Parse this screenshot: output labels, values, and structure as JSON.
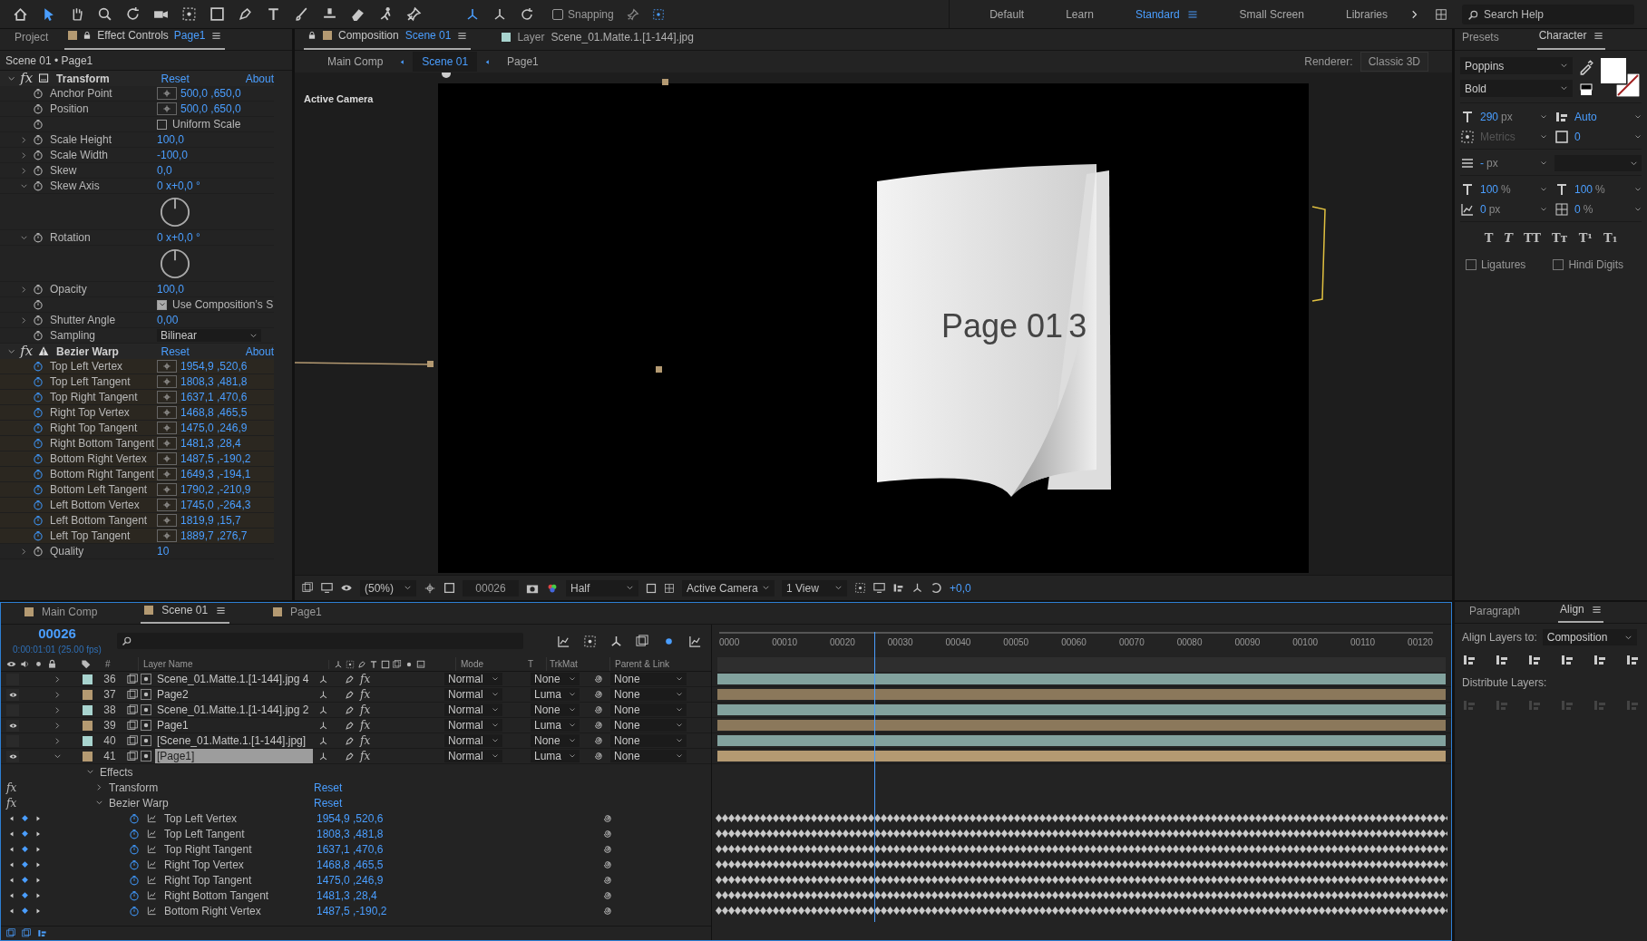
{
  "toolbar": {
    "snapping": {
      "label": "Snapping",
      "checked": false
    },
    "workspaces": [
      {
        "label": "Default",
        "selected": false
      },
      {
        "label": "Learn",
        "selected": false
      },
      {
        "label": "Standard",
        "selected": true
      },
      {
        "label": "Small Screen",
        "selected": false
      },
      {
        "label": "Libraries",
        "selected": false
      }
    ],
    "search": {
      "placeholder": "Search Help"
    }
  },
  "effect_controls": {
    "tabs": [
      {
        "label": "Project",
        "selected": false
      },
      {
        "label": "Effect Controls",
        "target": "Page1",
        "selected": true
      }
    ],
    "breadcrumb": "Scene 01 • Page1",
    "effects": [
      {
        "name": "Transform",
        "fx_label": "fx",
        "warning": false,
        "reset": "Reset",
        "about": "About",
        "props": [
          {
            "kind": "point",
            "name": "Anchor Point",
            "value": "500,0 ,650,0",
            "keyframed": false,
            "expandable": false
          },
          {
            "kind": "point",
            "name": "Position",
            "value": "500,0 ,650,0",
            "keyframed": false,
            "expandable": false
          },
          {
            "kind": "checkbox",
            "label": "Uniform Scale",
            "checked": false
          },
          {
            "kind": "value",
            "name": "Scale Height",
            "value": "100,0",
            "keyframed": false,
            "expandable": true
          },
          {
            "kind": "value",
            "name": "Scale Width",
            "value": "-100,0",
            "keyframed": false,
            "expandable": true
          },
          {
            "kind": "value",
            "name": "Skew",
            "value": "0,0",
            "keyframed": false,
            "expandable": true
          },
          {
            "kind": "dial",
            "name": "Skew Axis",
            "value": "0 x+0,0 °",
            "expanded": true
          },
          {
            "kind": "dial",
            "name": "Rotation",
            "value": "0 x+0,0 °",
            "expanded": true
          },
          {
            "kind": "value",
            "name": "Opacity",
            "value": "100,0",
            "keyframed": false,
            "expandable": true
          },
          {
            "kind": "checkbox",
            "label": "Use Composition’s S",
            "checked": true
          },
          {
            "kind": "value",
            "name": "Shutter Angle",
            "value": "0,00",
            "keyframed": false,
            "expandable": true
          },
          {
            "kind": "dropdown",
            "name": "Sampling",
            "value": "Bilinear"
          }
        ]
      },
      {
        "name": "Bezier Warp",
        "fx_label": "fx",
        "warning": true,
        "reset": "Reset",
        "about": "About",
        "props": [
          {
            "kind": "point",
            "name": "Top Left Vertex",
            "value": "1954,9 ,520,6",
            "keyframed": true,
            "expandable": false
          },
          {
            "kind": "point",
            "name": "Top Left Tangent",
            "value": "1808,3 ,481,8",
            "keyframed": true,
            "expandable": false
          },
          {
            "kind": "point",
            "name": "Top Right Tangent",
            "value": "1637,1 ,470,6",
            "keyframed": true,
            "expandable": false
          },
          {
            "kind": "point",
            "name": "Right Top Vertex",
            "value": "1468,8 ,465,5",
            "keyframed": true,
            "expandable": false
          },
          {
            "kind": "point",
            "name": "Right Top Tangent",
            "value": "1475,0 ,246,9",
            "keyframed": true,
            "expandable": false
          },
          {
            "kind": "point",
            "name": "Right Bottom Tangent",
            "value": "1481,3 ,28,4",
            "keyframed": true,
            "expandable": false
          },
          {
            "kind": "point",
            "name": "Bottom Right Vertex",
            "value": "1487,5 ,-190,2",
            "keyframed": true,
            "expandable": false
          },
          {
            "kind": "point",
            "name": "Bottom Right Tangent",
            "value": "1649,3 ,-194,1",
            "keyframed": true,
            "expandable": false
          },
          {
            "kind": "point",
            "name": "Bottom Left Tangent",
            "value": "1790,2 ,-210,9",
            "keyframed": true,
            "expandable": false
          },
          {
            "kind": "point",
            "name": "Left Bottom Vertex",
            "value": "1745,0 ,-264,3",
            "keyframed": true,
            "expandable": false
          },
          {
            "kind": "point",
            "name": "Left Bottom Tangent",
            "value": "1819,9 ,15,7",
            "keyframed": true,
            "expandable": false
          },
          {
            "kind": "point",
            "name": "Left Top Tangent",
            "value": "1889,7 ,276,7",
            "keyframed": true,
            "expandable": false
          },
          {
            "kind": "value",
            "name": "Quality",
            "value": "10",
            "keyframed": false,
            "expandable": true
          }
        ]
      }
    ]
  },
  "viewer": {
    "tabs": [
      {
        "label": "Composition",
        "target": "Scene 01",
        "color": "#b49a72",
        "selected": true
      },
      {
        "label": "Layer",
        "target": "Scene_01.Matte.1.[1-144].jpg",
        "color": "#a8d4cf",
        "selected": false
      }
    ],
    "breadcrumbs": [
      {
        "label": "Main Comp",
        "selected": false
      },
      {
        "label": "Scene 01",
        "selected": true
      },
      {
        "label": "Page1",
        "selected": false
      }
    ],
    "renderer_label": "Renderer:",
    "renderer": "Classic 3D",
    "camera_label": "Active Camera",
    "frame_texts": [
      "Page 01",
      "3"
    ],
    "controls": {
      "zoom": "(50%)",
      "frame": "00026",
      "resolution": "Half",
      "view": "Active Camera",
      "layout": "1 View",
      "exposure": "+0,0"
    }
  },
  "character": {
    "tabs": [
      {
        "label": "Presets",
        "selected": false
      },
      {
        "label": "Character",
        "selected": true
      }
    ],
    "font": "Poppins",
    "style": "Bold",
    "size": {
      "value": "290",
      "unit": "px"
    },
    "leading": "Auto",
    "kerning": "Metrics",
    "tracking": "0",
    "stroke": {
      "value": "-",
      "unit": "px"
    },
    "vscale": {
      "value": "100",
      "unit": "%"
    },
    "hscale": {
      "value": "100",
      "unit": "%"
    },
    "baseline": {
      "value": "0",
      "unit": "px"
    },
    "tsume": {
      "value": "0",
      "unit": "%"
    },
    "style_buttons": [
      "T",
      "T",
      "TT",
      "Tт",
      "T¹",
      "T₁"
    ],
    "options": [
      {
        "label": "Ligatures",
        "checked": false
      },
      {
        "label": "Hindi Digits",
        "checked": false
      }
    ]
  },
  "timeline": {
    "tabs": [
      {
        "label": "Main Comp",
        "color": "#b49a72",
        "selected": false
      },
      {
        "label": "Scene 01",
        "color": "#b49a72",
        "selected": true
      },
      {
        "label": "Page1",
        "color": "#b49a72",
        "selected": false
      }
    ],
    "timecode": "00026",
    "timecode_detail": "0:00:01:01 (25.00 fps)",
    "columns": [
      "#",
      "Layer Name",
      "Mode",
      "T",
      "TrkMat",
      "Parent & Link"
    ],
    "ruler": [
      "0000",
      "00010",
      "00020",
      "00030",
      "00040",
      "00050",
      "00060",
      "00070",
      "00080",
      "00090",
      "00100",
      "00110",
      "00120"
    ],
    "playhead": {
      "level": 0.217
    },
    "layers": [
      {
        "number": "36",
        "fx_label": "fx",
        "effects_on": true,
        "name": "Scene_01.Matte.1.[1-144].jpg 4",
        "color": "#a8d4cf",
        "visible": false,
        "mode": "Normal",
        "trkmat": "None",
        "parent": "None",
        "selected": false,
        "expanded": false
      },
      {
        "number": "37",
        "fx_label": "fx",
        "effects_on": true,
        "name": "Page2",
        "color": "#b49a72",
        "visible": true,
        "mode": "Normal",
        "trkmat": "Luma",
        "parent": "None",
        "selected": false,
        "expanded": false
      },
      {
        "number": "38",
        "fx_label": "fx",
        "effects_on": true,
        "name": "Scene_01.Matte.1.[1-144].jpg 2",
        "color": "#a8d4cf",
        "visible": false,
        "mode": "Normal",
        "trkmat": "None",
        "parent": "None",
        "selected": false,
        "expanded": false
      },
      {
        "number": "39",
        "fx_label": "fx",
        "effects_on": true,
        "name": "Page1",
        "color": "#b49a72",
        "visible": true,
        "mode": "Normal",
        "trkmat": "Luma",
        "parent": "None",
        "selected": false,
        "expanded": false
      },
      {
        "number": "40",
        "fx_label": "fx",
        "effects_on": true,
        "name": "[Scene_01.Matte.1.[1-144].jpg]",
        "color": "#a8d4cf",
        "visible": false,
        "mode": "Normal",
        "trkmat": "None",
        "parent": "None",
        "selected": false,
        "expanded": false
      },
      {
        "number": "41",
        "fx_label": "fx",
        "effects_on": true,
        "name": "[Page1]",
        "color": "#b49a72",
        "visible": true,
        "mode": "Normal",
        "trkmat": "Luma",
        "parent": "None",
        "selected": true,
        "expanded": true
      }
    ],
    "effects_label": "Effects",
    "effects": [
      {
        "name": "Transform",
        "fx_label": "fx",
        "reset": "Reset",
        "expanded": false
      },
      {
        "name": "Bezier Warp",
        "fx_label": "fx",
        "reset": "Reset",
        "expanded": true
      }
    ],
    "props": [
      {
        "name": "Top Left Vertex",
        "value": "1954,9 ,520,6"
      },
      {
        "name": "Top Left Tangent",
        "value": "1808,3 ,481,8"
      },
      {
        "name": "Top Right Tangent",
        "value": "1637,1 ,470,6"
      },
      {
        "name": "Right Top Vertex",
        "value": "1468,8 ,465,5"
      },
      {
        "name": "Right Top Tangent",
        "value": "1475,0 ,246,9"
      },
      {
        "name": "Right Bottom Tangent",
        "value": "1481,3 ,28,4"
      },
      {
        "name": "Bottom Right Vertex",
        "value": "1487,5 ,-190,2"
      }
    ]
  },
  "align": {
    "tabs": [
      {
        "label": "Paragraph",
        "selected": false
      },
      {
        "label": "Align",
        "selected": true
      }
    ],
    "align_to_label": "Align Layers to:",
    "align_to": "Composition",
    "distribute_label": "Distribute Layers:"
  }
}
